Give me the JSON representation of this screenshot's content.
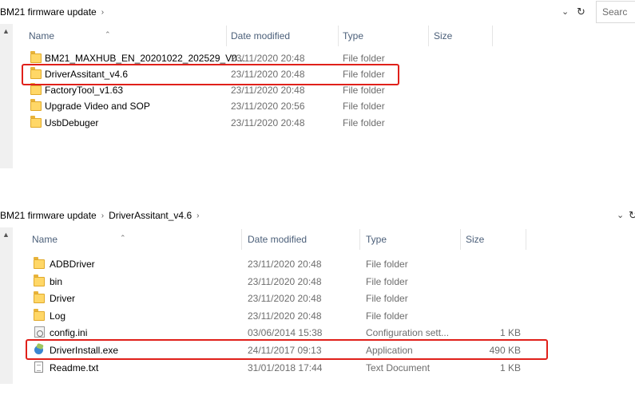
{
  "top_window": {
    "breadcrumb": [
      "BM21 firmware update"
    ],
    "search_placeholder": "Searc",
    "columns": {
      "name": "Name",
      "date": "Date modified",
      "type": "Type",
      "size": "Size"
    },
    "files": [
      {
        "name": "BM21_MAXHUB_EN_20201022_202529_V0...",
        "date": "23/11/2020 20:48",
        "type": "File folder",
        "size": "",
        "icon": "folder-icon"
      },
      {
        "name": "DriverAssitant_v4.6",
        "date": "23/11/2020 20:48",
        "type": "File folder",
        "size": "",
        "icon": "folder-icon"
      },
      {
        "name": "FactoryTool_v1.63",
        "date": "23/11/2020 20:48",
        "type": "File folder",
        "size": "",
        "icon": "folder-icon"
      },
      {
        "name": "Upgrade Video and SOP",
        "date": "23/11/2020 20:56",
        "type": "File folder",
        "size": "",
        "icon": "folder-icon"
      },
      {
        "name": "UsbDebuger",
        "date": "23/11/2020 20:48",
        "type": "File folder",
        "size": "",
        "icon": "folder-icon"
      }
    ]
  },
  "bottom_window": {
    "breadcrumb": [
      "BM21 firmware update",
      "DriverAssitant_v4.6"
    ],
    "columns": {
      "name": "Name",
      "date": "Date modified",
      "type": "Type",
      "size": "Size"
    },
    "files": [
      {
        "name": "ADBDriver",
        "date": "23/11/2020 20:48",
        "type": "File folder",
        "size": "",
        "icon": "folder-icon"
      },
      {
        "name": "bin",
        "date": "23/11/2020 20:48",
        "type": "File folder",
        "size": "",
        "icon": "folder-icon"
      },
      {
        "name": "Driver",
        "date": "23/11/2020 20:48",
        "type": "File folder",
        "size": "",
        "icon": "folder-icon"
      },
      {
        "name": "Log",
        "date": "23/11/2020 20:48",
        "type": "File folder",
        "size": "",
        "icon": "folder-icon"
      },
      {
        "name": "config.ini",
        "date": "03/06/2014 15:38",
        "type": "Configuration sett...",
        "size": "1 KB",
        "icon": "config-file-icon"
      },
      {
        "name": "DriverInstall.exe",
        "date": "24/11/2017 09:13",
        "type": "Application",
        "size": "490 KB",
        "icon": "application-icon"
      },
      {
        "name": "Readme.txt",
        "date": "31/01/2018 17:44",
        "type": "Text Document",
        "size": "1 KB",
        "icon": "text-document-icon"
      }
    ]
  },
  "highlight_color": "#e0201a"
}
